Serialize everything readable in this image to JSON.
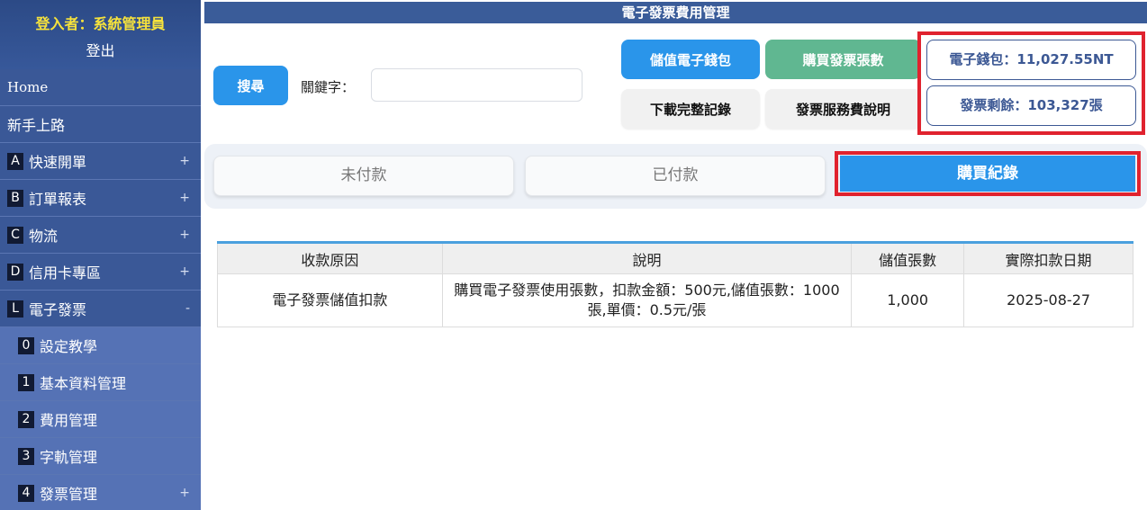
{
  "sidebar": {
    "user_label": "登入者：系統管理員",
    "logout": "登出",
    "items": [
      {
        "label": "Home"
      },
      {
        "label": "新手上路"
      },
      {
        "badge": "A",
        "label": "快速開單",
        "toggle": "+"
      },
      {
        "badge": "B",
        "label": "訂單報表",
        "toggle": "+"
      },
      {
        "badge": "C",
        "label": "物流",
        "toggle": "+"
      },
      {
        "badge": "D",
        "label": "信用卡專區",
        "toggle": "+"
      },
      {
        "badge": "L",
        "label": "電子發票",
        "toggle": "-"
      }
    ],
    "sub_items": [
      {
        "badge": "0",
        "label": "設定教學"
      },
      {
        "badge": "1",
        "label": "基本資料管理"
      },
      {
        "badge": "2",
        "label": "費用管理"
      },
      {
        "badge": "3",
        "label": "字軌管理"
      },
      {
        "badge": "4",
        "label": "發票管理",
        "toggle": "+"
      }
    ]
  },
  "header": {
    "title": "電子發票費用管理"
  },
  "toolbar": {
    "search_label": "搜尋",
    "keyword_label": "關鍵字：",
    "keyword_value": "",
    "topup_label": "儲值電子錢包",
    "buy_label": "購買發票張數",
    "download_label": "下載完整記錄",
    "fee_label": "發票服務費說明"
  },
  "info": {
    "wallet": "電子錢包：11,027.55NT",
    "remaining": "發票剩餘：103,327張"
  },
  "tabs": {
    "unpaid": "未付款",
    "paid": "已付款",
    "record": "購買紀錄"
  },
  "table": {
    "headers": [
      "收款原因",
      "說明",
      "儲值張數",
      "實際扣款日期"
    ],
    "rows": [
      {
        "reason": "電子發票儲值扣款",
        "desc": "購買電子發票使用張數，扣款金額：500元,儲值張數：1000張,單價：0.5元/張",
        "count": "1,000",
        "date": "2025-08-27"
      }
    ]
  },
  "colors": {
    "accent_blue": "#2a95ea",
    "green": "#60b791",
    "highlight_red": "#e0222e",
    "sidebar_bg": "#3d5b9c",
    "title_bar": "#3a5c99"
  }
}
